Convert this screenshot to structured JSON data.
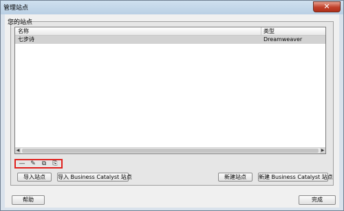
{
  "window": {
    "title": "管理站点",
    "close_glyph": "✕"
  },
  "sites_panel": {
    "title": "您的站点",
    "columns": [
      "名称",
      "类型"
    ],
    "rows": [
      {
        "name": "七步诗",
        "type": "Dreamweaver"
      }
    ]
  },
  "scrollbar": {
    "left_arrow": "◀",
    "right_arrow": "▶"
  },
  "toolbar": {
    "icons": [
      {
        "name": "remove-site-icon",
        "glyph": "—"
      },
      {
        "name": "edit-site-icon",
        "glyph": "✎"
      },
      {
        "name": "duplicate-site-icon",
        "glyph": "⧉"
      },
      {
        "name": "export-site-icon",
        "glyph": "⎘"
      }
    ]
  },
  "buttons": {
    "import_site": "导入站点",
    "import_bc_site": "导入 Business Catalyst 站点",
    "new_site": "新建站点",
    "new_bc_site": "新建 Business Catalyst 站点",
    "help": "帮助",
    "done": "完成"
  }
}
